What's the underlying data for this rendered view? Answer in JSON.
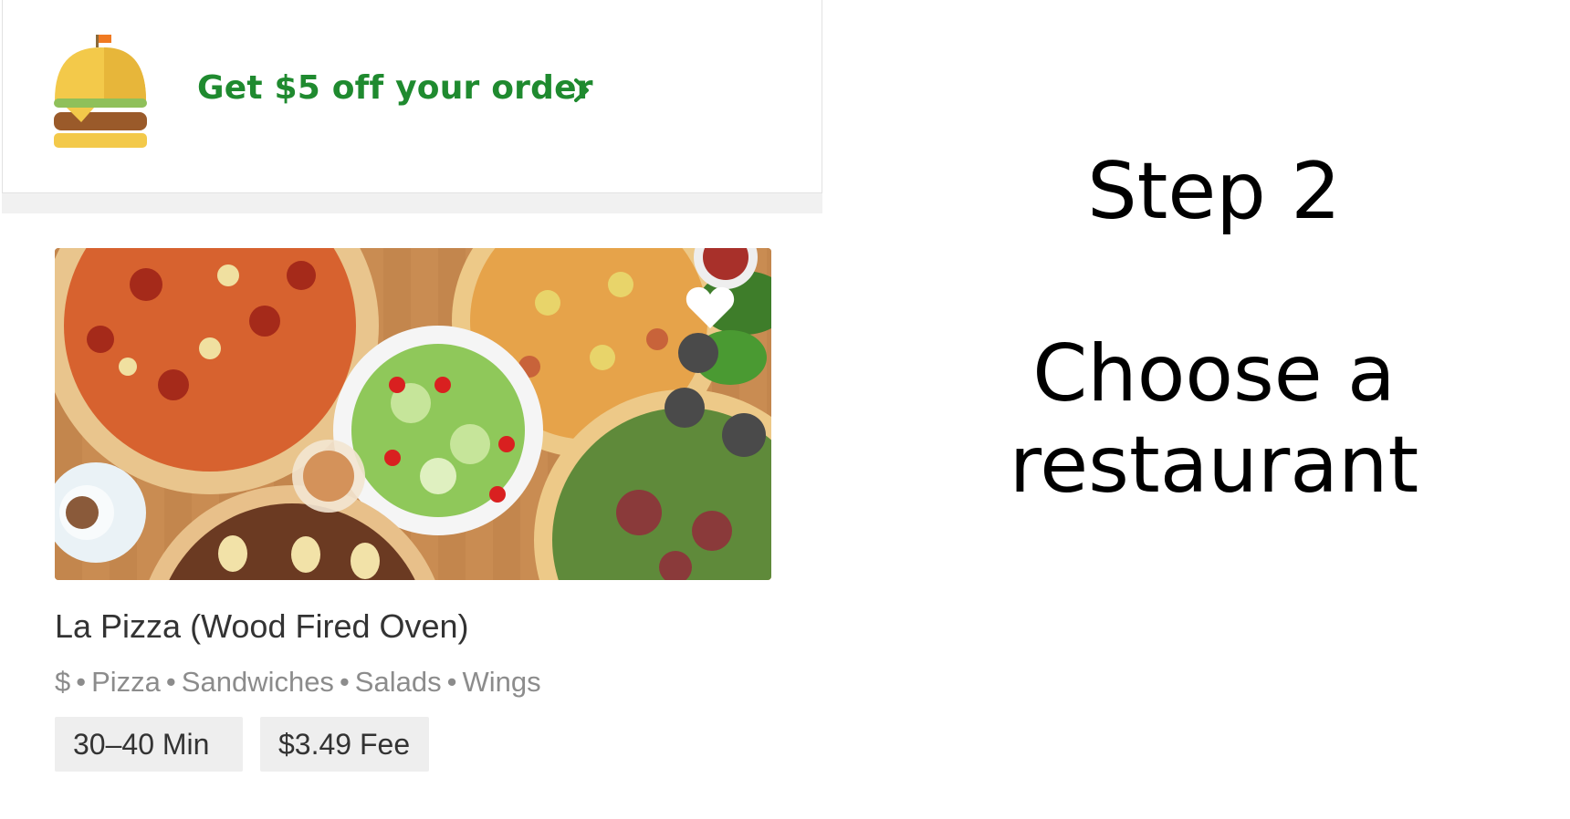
{
  "promo": {
    "text": "Get $5 off your order",
    "accent_color": "#1f8a2f",
    "icon": "burger-icon",
    "chevron_icon": "chevron-right-icon"
  },
  "restaurant": {
    "name": "La Pizza (Wood Fired Oven)",
    "price": "$",
    "categories": [
      "Pizza",
      "Sandwiches",
      "Salads",
      "Wings"
    ],
    "delivery_time": "30–40 Min",
    "fee": "$3.49 Fee",
    "favorite_icon": "heart-icon"
  },
  "caption": {
    "title": "Step 2",
    "description": "Choose a restaurant"
  }
}
